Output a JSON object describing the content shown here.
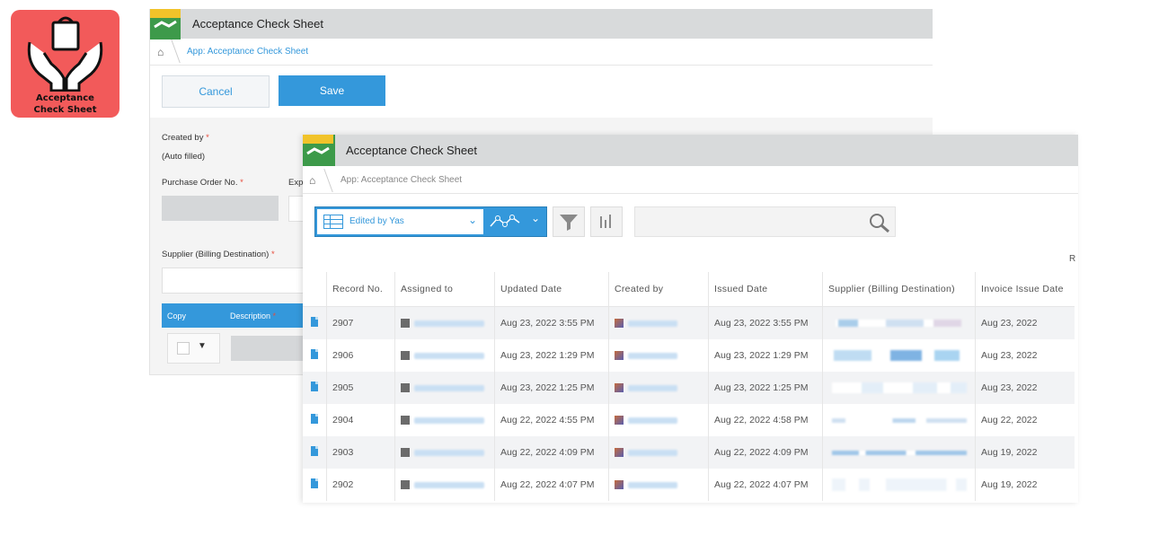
{
  "app_icon": {
    "line1": "Acceptance",
    "line2": "Check Sheet"
  },
  "back_window": {
    "title": "Acceptance Check Sheet",
    "breadcrumb": "App: Acceptance Check Sheet",
    "cancel_label": "Cancel",
    "save_label": "Save",
    "fields": {
      "created_by_label": "Created by",
      "created_by_value": "(Auto filled)",
      "po_label": "Purchase Order No.",
      "exp_label": "Exp",
      "supplier_label": "Supplier (Billing Destination)",
      "table_copy": "Copy",
      "table_description": "Description",
      "required_mark": "*"
    },
    "dropdown_arrow": "▼"
  },
  "front_window": {
    "title": "Acceptance Check Sheet",
    "breadcrumb": "App: Acceptance Check Sheet",
    "view_name": "Edited by Yas",
    "partial_right": "R",
    "columns": [
      "Record No.",
      "Assigned to",
      "Updated Date",
      "Created by",
      "Issued Date",
      "Supplier (Billing Destination)",
      "Invoice Issue Date"
    ],
    "rows": [
      {
        "record_no": "2907",
        "updated": "Aug 23, 2022 3:55 PM",
        "issued": "Aug 23, 2022 3:55 PM",
        "invoice": "Aug 23, 2022"
      },
      {
        "record_no": "2906",
        "updated": "Aug 23, 2022 1:29 PM",
        "issued": "Aug 23, 2022 1:29 PM",
        "invoice": "Aug 23, 2022"
      },
      {
        "record_no": "2905",
        "updated": "Aug 23, 2022 1:25 PM",
        "issued": "Aug 23, 2022 1:25 PM",
        "invoice": "Aug 23, 2022"
      },
      {
        "record_no": "2904",
        "updated": "Aug 22, 2022 4:55 PM",
        "issued": "Aug 22, 2022 4:58 PM",
        "invoice": "Aug 22, 2022"
      },
      {
        "record_no": "2903",
        "updated": "Aug 22, 2022 4:09 PM",
        "issued": "Aug 22, 2022 4:09 PM",
        "invoice": "Aug 19, 2022"
      },
      {
        "record_no": "2902",
        "updated": "Aug 22, 2022 4:07 PM",
        "issued": "Aug 22, 2022 4:07 PM",
        "invoice": "Aug 19, 2022"
      }
    ]
  },
  "colors": {
    "accent": "#3498db",
    "titlebar": "#d8dadb",
    "icon_bg": "#f25a5a",
    "required": "#e74c3c"
  }
}
